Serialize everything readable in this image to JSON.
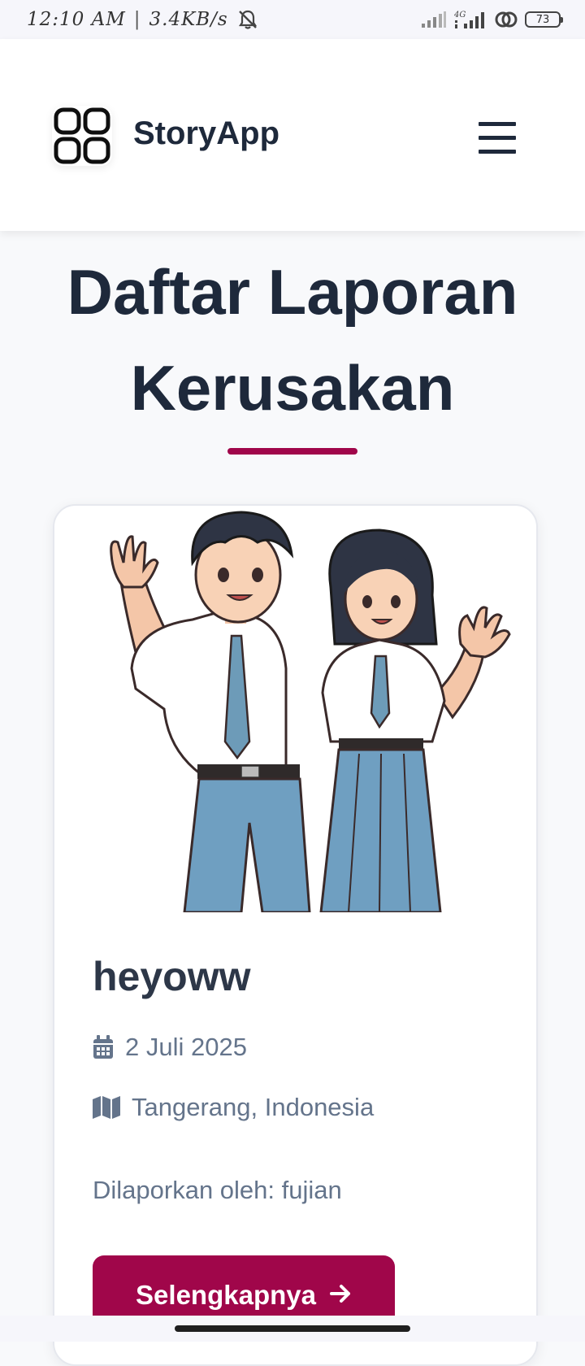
{
  "status_bar": {
    "time": "12:10  AM",
    "separator": "|",
    "speed": "3.4KB/s",
    "battery": "73",
    "network_label": "4G"
  },
  "header": {
    "brand": "StoryApp",
    "logo_icon": "grid-icon",
    "menu_icon": "hamburger-menu-icon"
  },
  "page": {
    "title": "Daftar Laporan Kerusakan",
    "accent_color": "#a0064a"
  },
  "story": {
    "title": "heyoww",
    "date": "2 Juli 2025",
    "location": "Tangerang, Indonesia",
    "reporter": "Dilaporkan oleh: fujian",
    "button_label": "Selengkapnya"
  }
}
